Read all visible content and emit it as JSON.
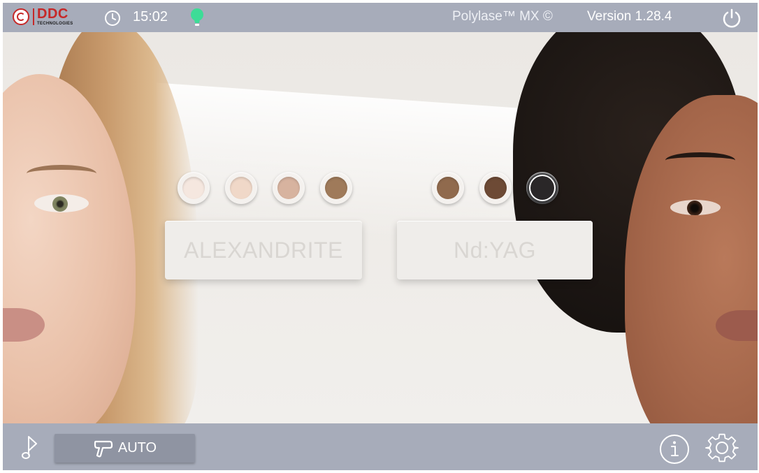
{
  "header": {
    "logo": {
      "brand": "DDC",
      "sub": "TECHNOLOGIES",
      "icon": "ddc-logo-icon"
    },
    "time": "15:02",
    "clock_icon": "clock-icon",
    "status_icon": "lightbulb-icon",
    "status_color": "#3ddc97",
    "product": "Polylase™ MX ©",
    "version": "Version 1.28.4",
    "power_icon": "power-icon"
  },
  "skin_tones": {
    "alexandrite": [
      {
        "color": "#f5e7df"
      },
      {
        "color": "#f0d8c8"
      },
      {
        "color": "#d7b39f"
      },
      {
        "color": "#9f7a5a"
      }
    ],
    "ndyag": [
      {
        "color": "#906a4d"
      },
      {
        "color": "#6d4a35"
      },
      {
        "color": "#2a2728",
        "selected": true
      }
    ]
  },
  "modes": {
    "alexandrite_label": "ALEXANDRITE",
    "ndyag_label": "Nd:YAG"
  },
  "footer": {
    "music_icon": "music-note-icon",
    "auto_label": "AUTO",
    "handpiece_icon": "handpiece-icon",
    "info_icon": "info-icon",
    "settings_icon": "gear-icon"
  },
  "colors": {
    "bar": "#a7acba",
    "auto_button": "#8f94a2",
    "brand_red": "#c62828"
  }
}
